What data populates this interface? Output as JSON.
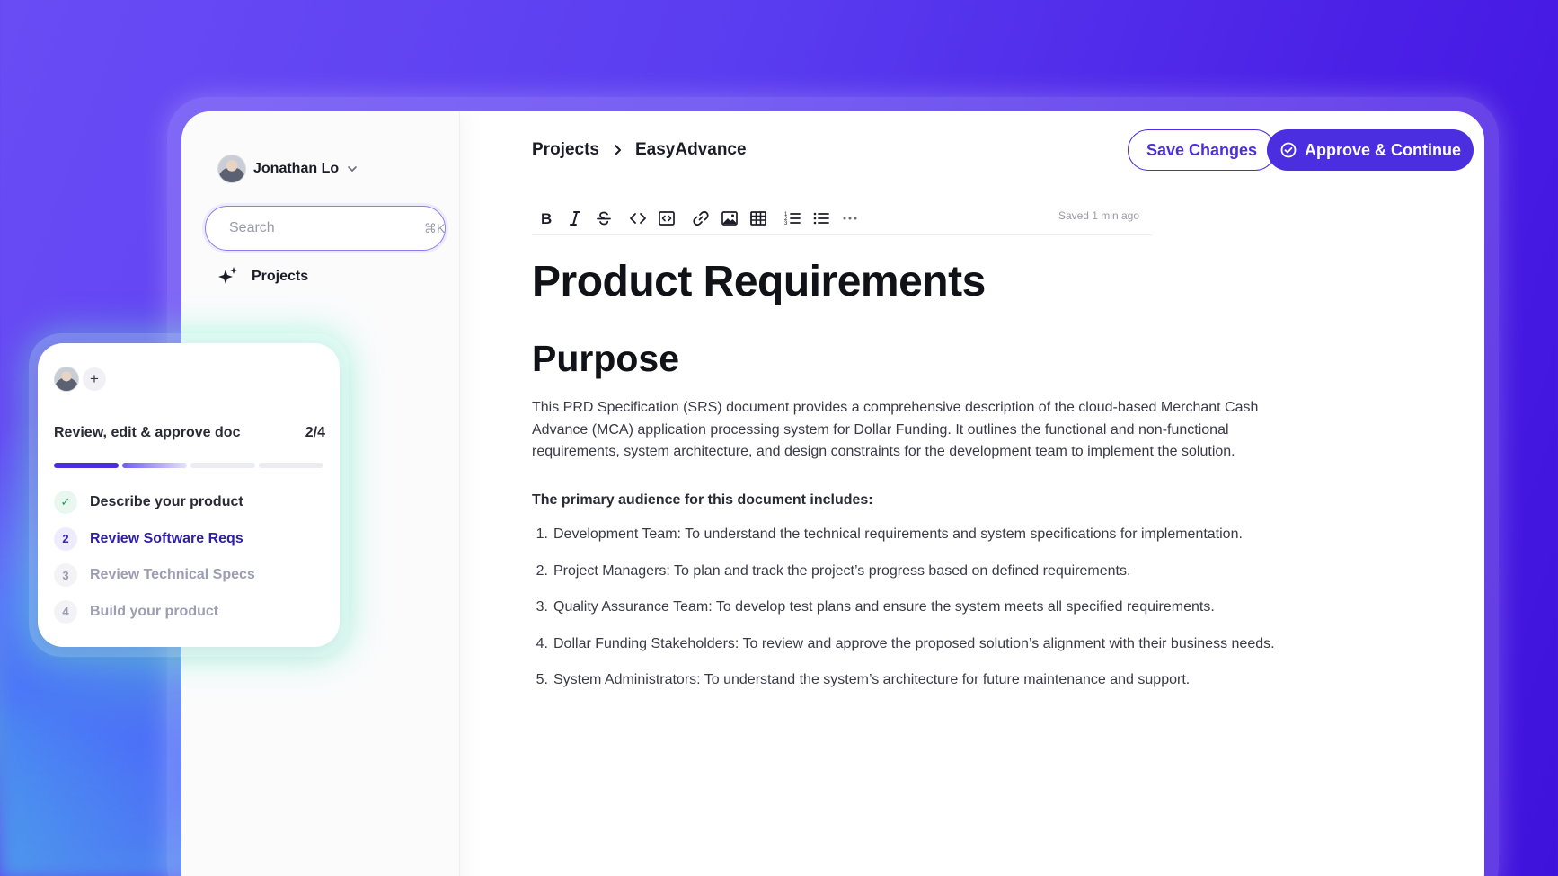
{
  "user": {
    "name": "Jonathan Lo"
  },
  "search": {
    "placeholder": "Search",
    "shortcut": "⌘K"
  },
  "sidebar": {
    "items": [
      {
        "label": "Projects",
        "icon": "sparkle-icon"
      }
    ]
  },
  "breadcrumb": {
    "root": "Projects",
    "current": "EasyAdvance"
  },
  "actions": {
    "save_label": "Save Changes",
    "approve_label": "Approve & Continue"
  },
  "toolbar": {
    "buttons": [
      "bold",
      "italic",
      "strikethrough",
      "inline-code",
      "code-block",
      "link",
      "image",
      "table",
      "ordered-list",
      "bullet-list",
      "more"
    ],
    "saved_status": "Saved 1 min ago"
  },
  "document": {
    "title": "Product Requirements",
    "heading": "Purpose",
    "intro": "This PRD Specification (SRS) document provides a comprehensive description of the cloud-based Merchant Cash Advance (MCA) application processing system for Dollar Funding. It outlines the functional and non-functional requirements, system architecture, and design constraints for the development team to implement the solution.",
    "audience_heading": "The primary audience for this document includes:",
    "audience": [
      {
        "num": "1.",
        "text": "Development Team: To understand the technical requirements and system specifications for implementation."
      },
      {
        "num": "2.",
        "text": "Project Managers: To plan and track the project’s progress based on defined requirements."
      },
      {
        "num": "3.",
        "text": "Quality Assurance Team: To develop test plans and ensure the system meets all specified requirements."
      },
      {
        "num": "4.",
        "text": "Dollar Funding Stakeholders: To review and approve the proposed solution’s alignment with their business needs."
      },
      {
        "num": "5.",
        "text": "System Administrators: To understand the system’s architecture for future maintenance and support."
      }
    ]
  },
  "task": {
    "title": "Review, edit & approve doc",
    "progress": "2/4",
    "add_label": "+",
    "steps": [
      {
        "badge": "✓",
        "label": "Describe your product",
        "state": "done"
      },
      {
        "badge": "2",
        "label": "Review Software Reqs",
        "state": "active"
      },
      {
        "badge": "3",
        "label": "Review Technical Specs",
        "state": "todo"
      },
      {
        "badge": "4",
        "label": "Build your product",
        "state": "todo"
      }
    ]
  },
  "colors": {
    "accent": "#4a2ee0",
    "success": "#1e9a55",
    "background": "#5a3df0"
  }
}
